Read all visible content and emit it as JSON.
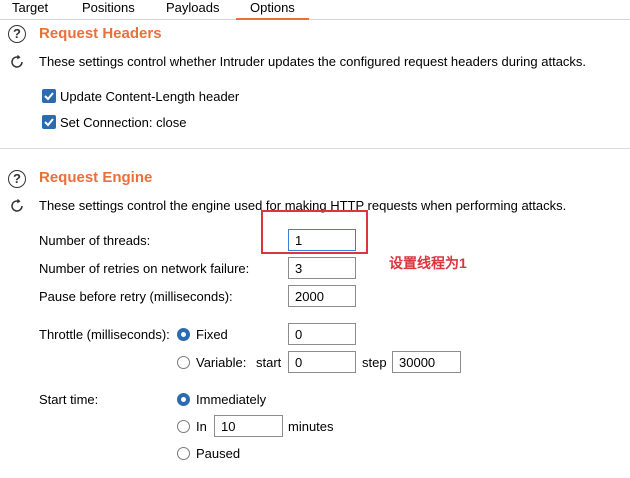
{
  "tabs": [
    {
      "label": "Target"
    },
    {
      "label": "Positions"
    },
    {
      "label": "Payloads"
    },
    {
      "label": "Options",
      "active": true
    }
  ],
  "request_headers": {
    "title": "Request Headers",
    "description": "These settings control whether Intruder updates the configured request headers during attacks.",
    "update_content_length": {
      "label": "Update Content-Length header",
      "checked": true
    },
    "set_connection_close": {
      "label": "Set Connection: close",
      "checked": true
    }
  },
  "request_engine": {
    "title": "Request Engine",
    "description": "These settings control the engine used for making HTTP requests when performing attacks.",
    "threads": {
      "label": "Number of threads:",
      "value": "1"
    },
    "retries": {
      "label": "Number of retries on network failure:",
      "value": "3"
    },
    "pause": {
      "label": "Pause before retry (milliseconds):",
      "value": "2000"
    },
    "throttle": {
      "label": "Throttle (milliseconds):",
      "fixed_label": "Fixed",
      "fixed_value": "0",
      "variable_label": "Variable:",
      "start_label": "start",
      "start_value": "0",
      "step_label": "step",
      "step_value": "30000",
      "selected": "fixed"
    },
    "start_time": {
      "label": "Start time:",
      "immediately_label": "Immediately",
      "in_label": "In",
      "in_value": "10",
      "minutes_label": "minutes",
      "paused_label": "Paused",
      "selected": "immediately"
    }
  },
  "annotation": {
    "text": "设置线程为1"
  },
  "colors": {
    "accent": "#e8703a",
    "checkbox": "#2b6cb0",
    "annotation": "#d9363e"
  }
}
